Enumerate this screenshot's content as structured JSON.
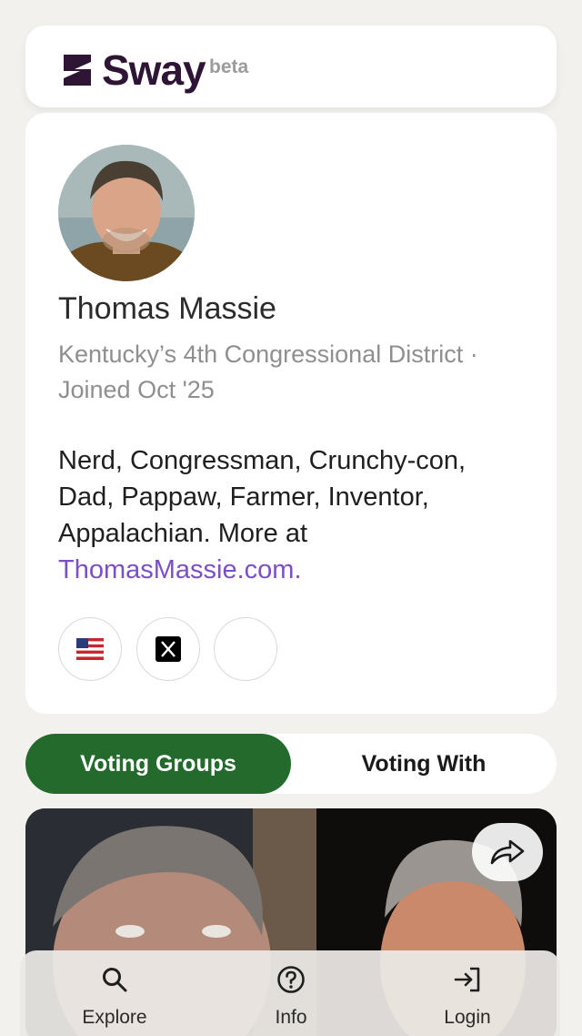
{
  "header": {
    "brand": "Sway",
    "badge": "beta"
  },
  "profile": {
    "name": "Thomas Massie",
    "meta": "Kentucky’s 4th Congressional District · Joined Oct '25",
    "bio": "Nerd, Congressman, Crunchy-con, Dad, Pappaw, Farmer, Inventor, Appalachian. More at ",
    "bio_link": "ThomasMassie.com.",
    "social_icons": [
      "us-flag-icon",
      "x-logo-icon",
      "empty-icon"
    ]
  },
  "tabs": [
    {
      "label": "Voting Groups",
      "active": true
    },
    {
      "label": "Voting With",
      "active": false
    }
  ],
  "bottom_nav": [
    {
      "label": "Explore",
      "icon": "search-icon"
    },
    {
      "label": "Info",
      "icon": "help-circle-icon"
    },
    {
      "label": "Login",
      "icon": "login-icon"
    }
  ],
  "colors": {
    "brand": "#2f1535",
    "active_tab": "#236a2c",
    "link": "#7b4fc6"
  }
}
